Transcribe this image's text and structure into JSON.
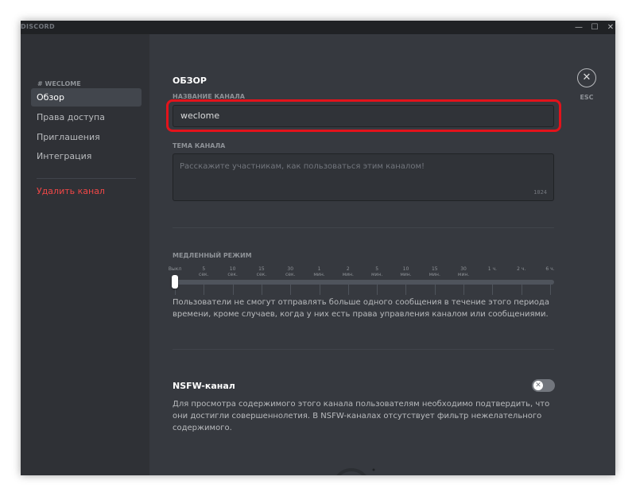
{
  "titlebar": {
    "app_name": "DISCORD",
    "buttons": [
      {
        "icon": "minimize-icon",
        "glyph": "—"
      },
      {
        "icon": "maximize-icon",
        "glyph": "☐"
      },
      {
        "icon": "close-window-icon",
        "glyph": "✕"
      }
    ]
  },
  "sidebar": {
    "header": "# WECLOME",
    "items": [
      {
        "label": "Обзор",
        "active": true
      },
      {
        "label": "Права доступа"
      },
      {
        "label": "Приглашения"
      },
      {
        "label": "Интеграция"
      }
    ],
    "delete_label": "Удалить канал"
  },
  "main": {
    "section_title": "ОБЗОР",
    "channel_name": {
      "label": "НАЗВАНИЕ КАНАЛА",
      "value": "weclome"
    },
    "channel_topic": {
      "label": "ТЕМА КАНАЛА",
      "placeholder": "Расскажите участникам, как пользоваться этим каналом!",
      "max_length": "1024"
    },
    "slowmode": {
      "label": "МЕДЛЕННЫЙ РЕЖИМ",
      "ticks": [
        "Выкл",
        "5\nсек.",
        "10\nсек.",
        "15\nсек.",
        "30\nсек.",
        "1\nмин.",
        "2\nмин.",
        "5\nмин.",
        "10\nмин.",
        "15\nмин.",
        "30\nмин.",
        "1 ч.",
        "2 ч.",
        "6 ч."
      ],
      "selected": "Выкл",
      "description": "Пользователи не смогут отправлять больше одного сообщения в течение этого периода времени, кроме случаев, когда у них есть права управления каналом или сообщениями."
    },
    "nsfw": {
      "title": "NSFW-канал",
      "enabled": false,
      "description": "Для просмотра содержимого этого канала пользователям необходимо подтвердить, что они достигли совершеннолетия. В NSFW-каналах отсутствует фильтр нежелательного содержимого."
    }
  },
  "close": {
    "icon": "close-icon",
    "glyph": "✕",
    "esc_label": "ESC"
  },
  "colors": {
    "background": "#36393f",
    "sidebar": "#2f3136",
    "titlebar": "#202225",
    "danger": "#f04747",
    "highlight": "#e3131b"
  }
}
